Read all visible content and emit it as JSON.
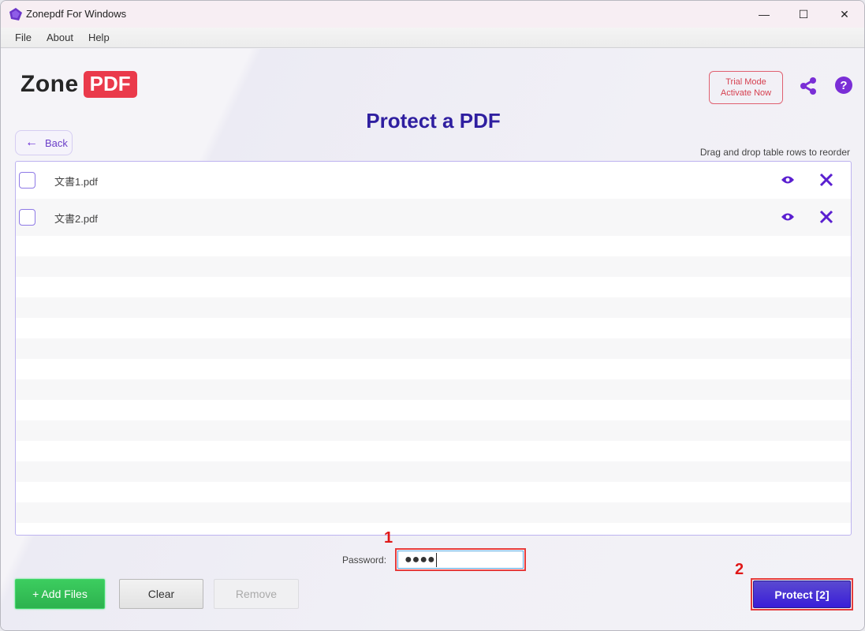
{
  "window": {
    "title": "Zonepdf For Windows",
    "controls": {
      "minimize": "—",
      "maximize": "☐",
      "close": "✕"
    }
  },
  "menu": {
    "items": [
      "File",
      "About",
      "Help"
    ]
  },
  "header": {
    "logo_text": "Zone",
    "logo_badge": "PDF",
    "trial_line1": "Trial Mode",
    "trial_line2": "Activate Now",
    "help_glyph": "?"
  },
  "page": {
    "title": "Protect a PDF",
    "back_label": "Back",
    "drag_hint": "Drag and drop table rows to reorder"
  },
  "files": [
    {
      "name": "文書1.pdf",
      "checked": false
    },
    {
      "name": "文書2.pdf",
      "checked": false
    }
  ],
  "password": {
    "label": "Password:",
    "masked_value": "●●●●"
  },
  "annotations": {
    "step1": "1",
    "step2": "2"
  },
  "buttons": {
    "add_files": "+ Add Files",
    "clear": "Clear",
    "remove": "Remove",
    "protect": "Protect [2]"
  },
  "colors": {
    "accent": "#6a2ed6",
    "title": "#2f1fa0",
    "brand_red": "#ea3a4b",
    "add_green": "#34c057",
    "protect_blue": "#3a1ed8",
    "annotation_red": "#e01818"
  }
}
